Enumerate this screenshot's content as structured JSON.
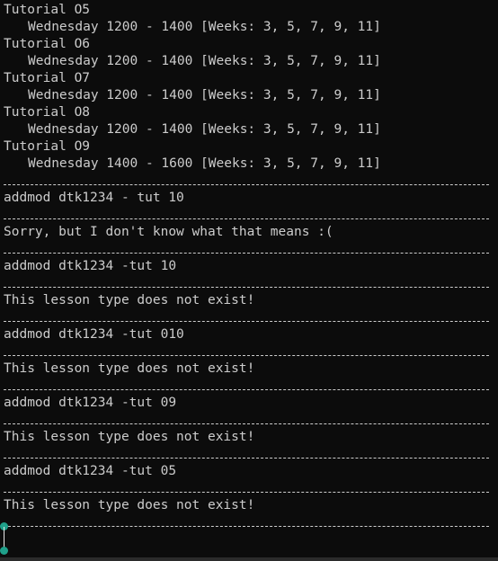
{
  "terminal": {
    "tutorials": [
      {
        "label": "Tutorial O5",
        "schedule": "Wednesday 1200 - 1400 [Weeks: 3, 5, 7, 9, 11]"
      },
      {
        "label": "Tutorial O6",
        "schedule": "Wednesday 1200 - 1400 [Weeks: 3, 5, 7, 9, 11]"
      },
      {
        "label": "Tutorial O7",
        "schedule": "Wednesday 1200 - 1400 [Weeks: 3, 5, 7, 9, 11]"
      },
      {
        "label": "Tutorial O8",
        "schedule": "Wednesday 1200 - 1400 [Weeks: 3, 5, 7, 9, 11]"
      },
      {
        "label": "Tutorial O9",
        "schedule": "Wednesday 1400 - 1600 [Weeks: 3, 5, 7, 9, 11]"
      }
    ],
    "exchanges": [
      {
        "command": "addmod dtk1234 - tut 10",
        "response": "Sorry, but I don't know what that means :("
      },
      {
        "command": "addmod dtk1234 -tut 10",
        "response": "This lesson type does not exist!"
      },
      {
        "command": "addmod dtk1234 -tut 010",
        "response": "This lesson type does not exist!"
      },
      {
        "command": "addmod dtk1234 -tut 09",
        "response": "This lesson type does not exist!"
      },
      {
        "command": "addmod dtk1234 -tut 05",
        "response": "This lesson type does not exist!"
      }
    ]
  },
  "colors": {
    "background": "#0c0c0c",
    "foreground": "#cccccc",
    "cursor_handle": "#1fa08a"
  },
  "icons": {
    "cursor": "text-selection-cursor-icon"
  }
}
